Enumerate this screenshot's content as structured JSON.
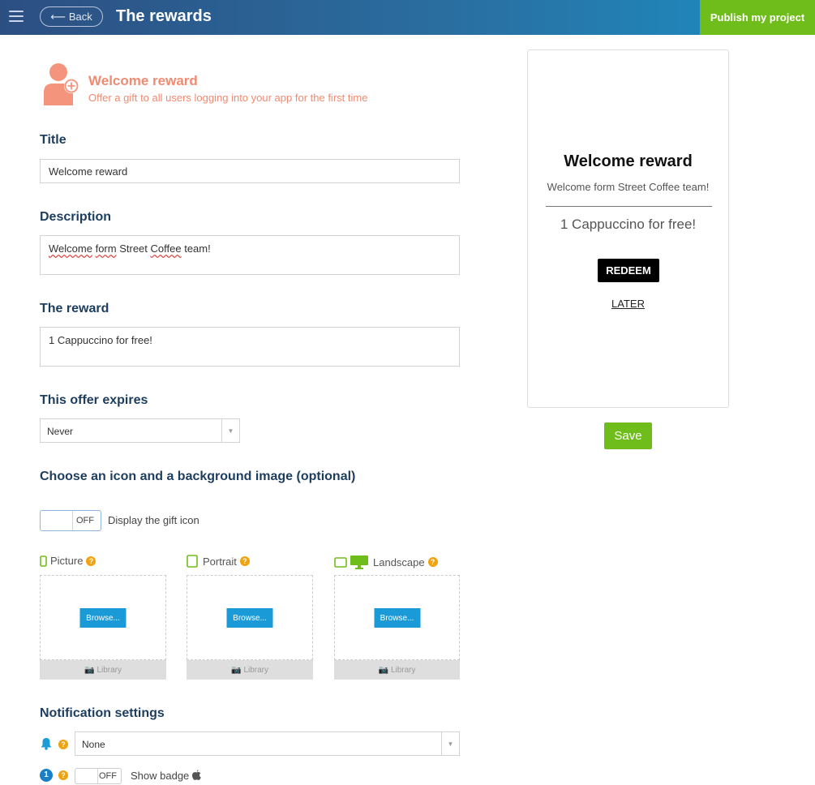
{
  "topbar": {
    "back_label": "Back",
    "title": "The rewards",
    "publish_label": "Publish my project"
  },
  "reward_header": {
    "name": "Welcome reward",
    "subtitle": "Offer a gift to all users logging into your app for the first time"
  },
  "form": {
    "title_label": "Title",
    "title_value": "Welcome reward",
    "description_label": "Description",
    "description_words": [
      "Welcome",
      "form",
      "Street",
      "Coffee"
    ],
    "description_tail": "team!",
    "reward_label": "The reward",
    "reward_value": "1 Cappuccino for free!",
    "expires_label": "This offer expires",
    "expires_value": "Never",
    "icon_section_label": "Choose an icon and a background image (optional)",
    "gift_toggle_state": "OFF",
    "gift_toggle_label": "Display the gift icon"
  },
  "media": [
    {
      "label": "Picture",
      "browse": "Browse...",
      "library": "Library"
    },
    {
      "label": "Portrait",
      "browse": "Browse...",
      "library": "Library"
    },
    {
      "label": "Landscape",
      "browse": "Browse...",
      "library": "Library"
    }
  ],
  "help_glyph": "?",
  "notification": {
    "section_label": "Notification settings",
    "select_value": "None",
    "badge_number": "1",
    "badge_toggle_state": "OFF",
    "badge_label": "Show badge"
  },
  "preview": {
    "title": "Welcome reward",
    "description": "Welcome form Street Coffee team!",
    "reward": "1 Cappuccino for free!",
    "redeem_label": "REDEEM",
    "later_label": "LATER",
    "save_label": "Save"
  },
  "colors": {
    "accent_green": "#6fbd1a",
    "brand_blue": "#1a9bd8",
    "salmon": "#f08b72",
    "heading_navy": "#1d3d5e",
    "help_orange": "#f0a20f"
  },
  "icons": [
    "menu-icon",
    "back-arrow-icon",
    "add-user-icon",
    "phone-icon",
    "tablet-icon",
    "monitor-icon",
    "camera-icon",
    "bell-icon",
    "apple-icon"
  ]
}
